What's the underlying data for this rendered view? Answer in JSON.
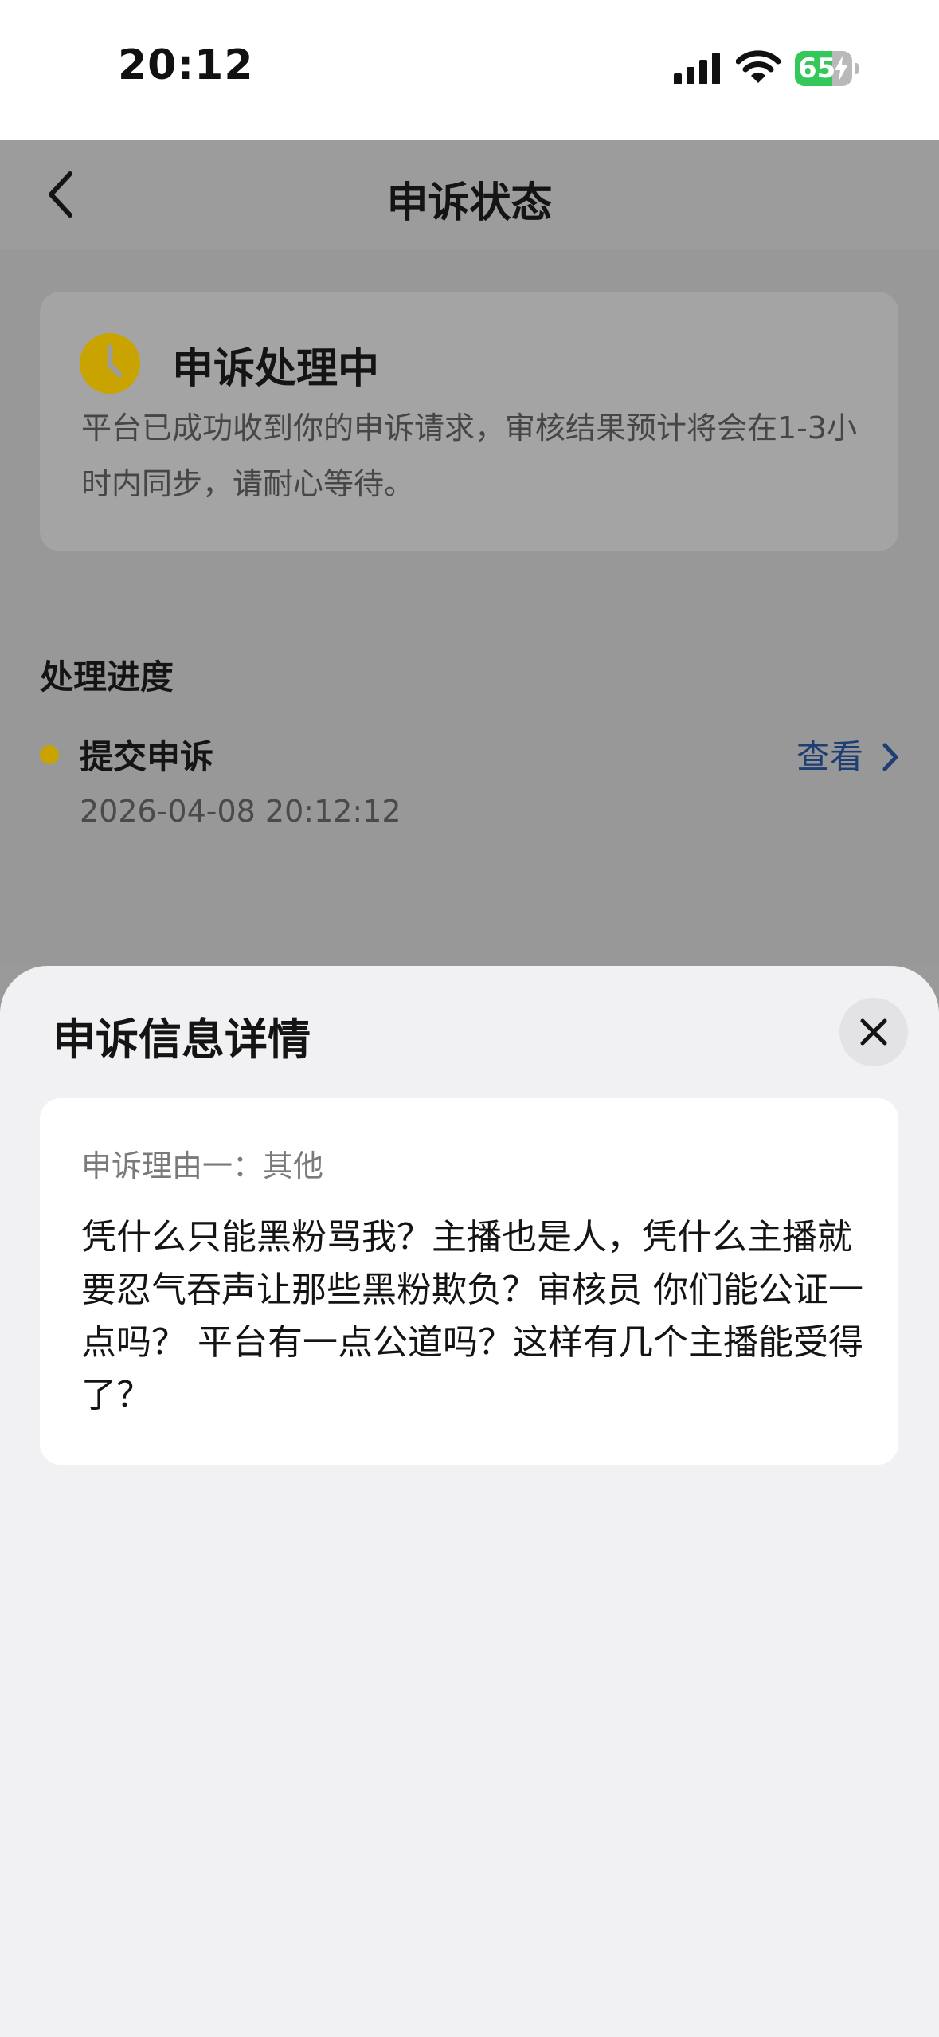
{
  "status_bar": {
    "time": "20:12",
    "battery_level": "65",
    "battery_fill_fraction": 0.65,
    "battery_color": "#34c759"
  },
  "nav": {
    "title": "申诉状态",
    "back_icon": "chevron-left-icon"
  },
  "status_card": {
    "icon": "clock-icon",
    "title": "申诉处理中",
    "description": "平台已成功收到你的申诉请求，审核结果预计将会在1-3小时内同步，请耐心等待。",
    "accent_color": "#c9a300"
  },
  "progress": {
    "section_title": "处理进度",
    "steps": [
      {
        "title": "提交申诉",
        "time": "2026-04-08 20:12:12",
        "action_label": "查看"
      }
    ],
    "link_color": "#1f3e73"
  },
  "sheet": {
    "title": "申诉信息详情",
    "close_icon": "close-icon",
    "reason_label": "申诉理由一：其他",
    "reason_text": "凭什么只能黑粉骂我？主播也是人，凭什么主播就要忍气吞声让那些黑粉欺负？审核员 你们能公证一点吗？ 平台有一点公道吗？这样有几个主播能受得了？"
  }
}
